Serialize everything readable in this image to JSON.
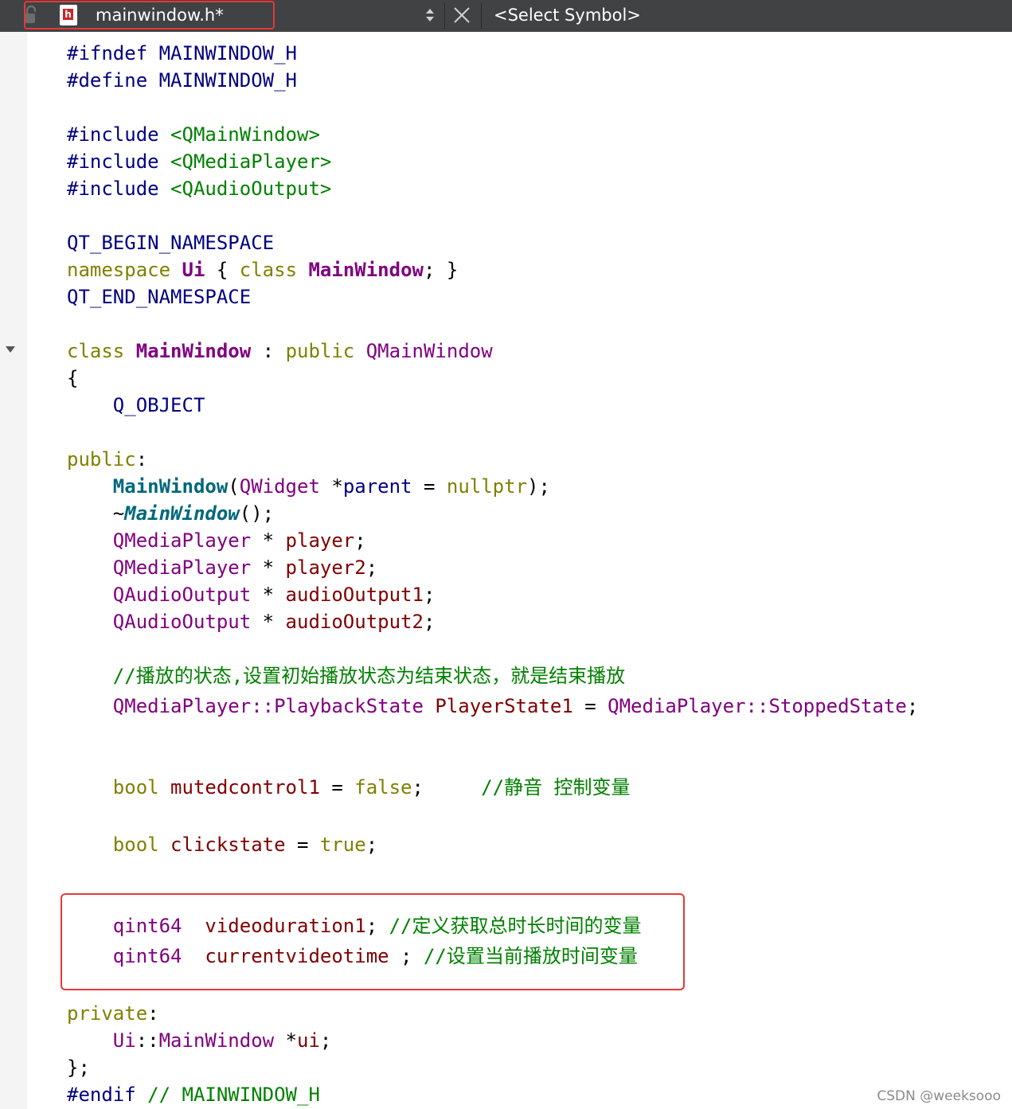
{
  "toolbar": {
    "file_name": "mainwindow.h*",
    "file_icon_letter": "h",
    "symbol_selector": "<Select Symbol>",
    "lock_icon": "lock-icon",
    "updown_icon": "updown-arrows-icon",
    "close_icon": "close-icon"
  },
  "code": {
    "l01": [
      "#ifndef MAINWINDOW_H"
    ],
    "l02": [
      "#define MAINWINDOW_H"
    ],
    "l04": [
      "#include ",
      "<QMainWindow>"
    ],
    "l05": [
      "#include ",
      "<QMediaPlayer>"
    ],
    "l06": [
      "#include ",
      "<QAudioOutput>"
    ],
    "l08": [
      "QT_BEGIN_NAMESPACE"
    ],
    "l09": [
      "namespace",
      " ",
      "Ui",
      " { ",
      "class",
      " ",
      "MainWindow",
      "; }"
    ],
    "l10": [
      "QT_END_NAMESPACE"
    ],
    "l12": [
      "class",
      " ",
      "MainWindow",
      " : ",
      "public",
      " ",
      "QMainWindow"
    ],
    "l13": [
      "{"
    ],
    "l14": [
      "    ",
      "Q_OBJECT"
    ],
    "l16": [
      "public",
      ":"
    ],
    "l17": [
      "    ",
      "MainWindow",
      "(",
      "QWidget",
      " *",
      "parent",
      " = ",
      "nullptr",
      ");"
    ],
    "l18": [
      "    ~",
      "MainWindow",
      "();"
    ],
    "l19": [
      "    ",
      "QMediaPlayer",
      " * ",
      "player",
      ";"
    ],
    "l20": [
      "    ",
      "QMediaPlayer",
      " * ",
      "player2",
      ";"
    ],
    "l21": [
      "    ",
      "QAudioOutput",
      " * ",
      "audioOutput1",
      ";"
    ],
    "l22": [
      "    ",
      "QAudioOutput",
      " * ",
      "audioOutput2",
      ";"
    ],
    "l24": [
      "    ",
      "//播放的状态,设置初始播放状态为结束状态，就是结束播放"
    ],
    "l25": [
      "    ",
      "QMediaPlayer",
      "::",
      "PlaybackState",
      " ",
      "PlayerState1",
      " = ",
      "QMediaPlayer",
      "::",
      "StoppedState",
      ";"
    ],
    "l28": [
      "    ",
      "bool",
      " ",
      "mutedcontrol1",
      " = ",
      "false",
      ";     ",
      "//静音 控制变量"
    ],
    "l30": [
      "    ",
      "bool",
      " ",
      "clickstate",
      " = ",
      "true",
      ";"
    ],
    "l33": [
      "    ",
      "qint64",
      "  ",
      "videoduration1",
      "; ",
      "//定义获取总时长时间的变量"
    ],
    "l34": [
      "    ",
      "qint64",
      "  ",
      "currentvideotime",
      " ; ",
      "//设置当前播放时间变量"
    ],
    "l36": [
      "private",
      ":"
    ],
    "l37": [
      "    ",
      "Ui",
      "::",
      "MainWindow",
      " *",
      "ui",
      ";"
    ],
    "l38": [
      "};"
    ],
    "l39": [
      "#endif ",
      "// MAINWINDOW_H"
    ]
  },
  "watermark": "CSDN @weeksooo",
  "colors": {
    "toolbar_bg": "#404244",
    "highlight_border": "#e53935",
    "keyword": "#808000",
    "type": "#800080",
    "comment": "#008000",
    "function": "#00677c"
  }
}
